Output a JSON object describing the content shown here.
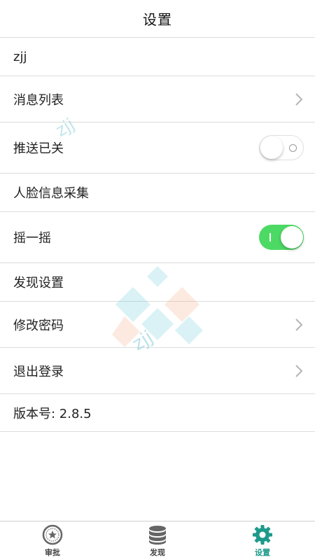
{
  "header": {
    "title": "设置"
  },
  "rows": {
    "user": {
      "label": "zjj"
    },
    "messages": {
      "label": "消息列表"
    },
    "push": {
      "label": "推送已关",
      "toggle": "off"
    },
    "face": {
      "label": "人脸信息采集"
    },
    "shake": {
      "label": "摇一摇",
      "toggle": "on"
    },
    "discover_settings": {
      "label": "发现设置"
    },
    "change_password": {
      "label": "修改密码"
    },
    "logout": {
      "label": "退出登录"
    },
    "version": {
      "label": "版本号: 2.8.5"
    }
  },
  "watermark": {
    "text": "zjj"
  },
  "tabbar": {
    "items": [
      {
        "label": "审批",
        "icon": "approval-icon"
      },
      {
        "label": "发现",
        "icon": "database-icon"
      },
      {
        "label": "设置",
        "icon": "gear-icon",
        "active": true
      }
    ]
  },
  "colors": {
    "accent": "#1d9a8a",
    "toggle_on": "#4cd964",
    "divider": "#dcdcdc"
  }
}
